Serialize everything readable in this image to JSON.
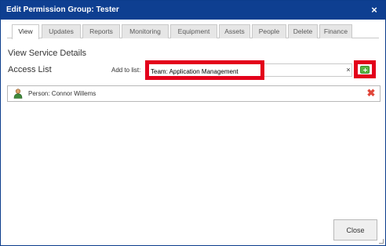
{
  "dialog": {
    "title": "Edit Permission Group: Tester",
    "close_symbol": "×"
  },
  "tabs": [
    {
      "label": "View",
      "active": true
    },
    {
      "label": "Updates",
      "active": false
    },
    {
      "label": "Reports",
      "active": false
    },
    {
      "label": "Monitoring",
      "active": false
    },
    {
      "label": "Equipment",
      "active": false
    },
    {
      "label": "Assets",
      "active": false
    },
    {
      "label": "People",
      "active": false
    },
    {
      "label": "Delete",
      "active": false
    },
    {
      "label": "Finance",
      "active": false
    }
  ],
  "section": {
    "title": "View Service Details",
    "access_title": "Access List"
  },
  "add_to_list": {
    "label": "Add to list:",
    "value": "Team: Application Management",
    "clear_symbol": "×",
    "add_icon": "add-icon"
  },
  "access_list": [
    {
      "label": "Person: Connor Willems",
      "icon": "person-icon",
      "remove_symbol": "✖"
    }
  ],
  "footer": {
    "close_label": "Close"
  },
  "colors": {
    "titlebar": "#0e3f91",
    "highlight": "#e3001b",
    "add_green": "#5bb545",
    "remove_red": "#e0463a"
  }
}
